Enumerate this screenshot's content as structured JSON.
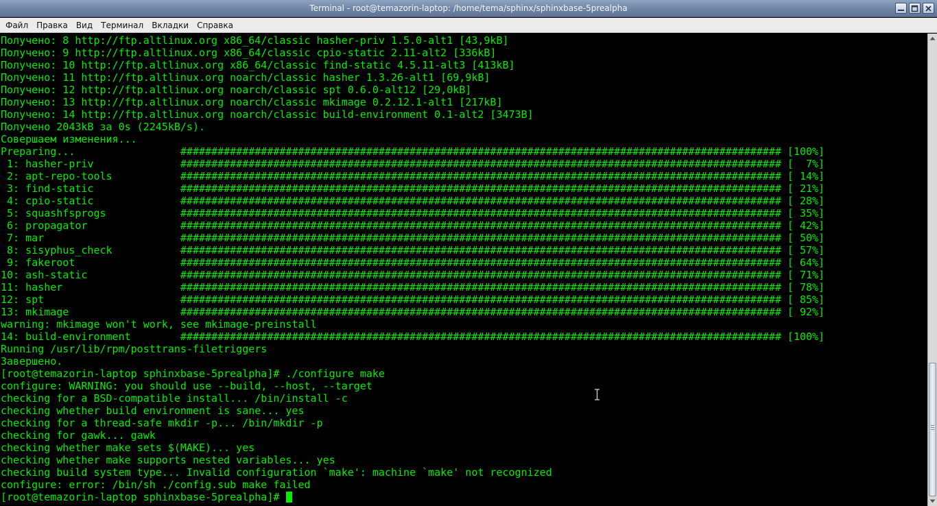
{
  "window": {
    "title": "Terminal - root@temazorin-laptop: /home/tema/sphinx/sphinxbase-5prealpha"
  },
  "menu": {
    "items": [
      "Файл",
      "Правка",
      "Вид",
      "Терминал",
      "Вкладки",
      "Справка"
    ]
  },
  "terminal": {
    "text_color": "#00ee00",
    "background": "#000000",
    "lines": [
      "Получено: 8 http://ftp.altlinux.org x86_64/classic hasher-priv 1.5.0-alt1 [43,9kB]",
      "Получено: 9 http://ftp.altlinux.org x86_64/classic cpio-static 2.11-alt2 [336kB]",
      "Получено: 10 http://ftp.altlinux.org x86_64/classic find-static 4.5.11-alt3 [413kB]",
      "Получено: 11 http://ftp.altlinux.org noarch/classic hasher 1.3.26-alt1 [69,9kB]",
      "Получено: 12 http://ftp.altlinux.org noarch/classic spt 0.6.0-alt12 [29,0kB]",
      "Получено: 13 http://ftp.altlinux.org noarch/classic mkimage 0.2.12.1-alt1 [217kB]",
      "Получено: 14 http://ftp.altlinux.org noarch/classic build-environment 0.1-alt2 [3473B]",
      "Получено 2043kB за 0s (2245kB/s).",
      "Совершаем изменения...",
      "Preparing...                 ################################################################################################# [100%]",
      " 1: hasher-priv              ################################################################################################# [  7%]",
      " 2: apt-repo-tools           ################################################################################################# [ 14%]",
      " 3: find-static              ################################################################################################# [ 21%]",
      " 4: cpio-static              ################################################################################################# [ 28%]",
      " 5: squashfsprogs            ################################################################################################# [ 35%]",
      " 6: propagator               ################################################################################################# [ 42%]",
      " 7: mar                      ################################################################################################# [ 50%]",
      " 8: sisyphus_check           ################################################################################################# [ 57%]",
      " 9: fakeroot                 ################################################################################################# [ 64%]",
      "10: ash-static               ################################################################################################# [ 71%]",
      "11: hasher                   ################################################################################################# [ 78%]",
      "12: spt                      ################################################################################################# [ 85%]",
      "13: mkimage                  ################################################################################################# [ 92%]",
      "warning: mkimage won't work, see mkimage-preinstall",
      "14: build-environment        ################################################################################################# [100%]",
      "Running /usr/lib/rpm/posttrans-filetriggers",
      "Завершено.",
      "[root@temazorin-laptop sphinxbase-5prealpha]# ./configure make",
      "configure: WARNING: you should use --build, --host, --target",
      "checking for a BSD-compatible install... /bin/install -c",
      "checking whether build environment is sane... yes",
      "checking for a thread-safe mkdir -p... /bin/mkdir -p",
      "checking for gawk... gawk",
      "checking whether make sets $(MAKE)... yes",
      "checking whether make supports nested variables... yes",
      "checking build system type... Invalid configuration `make': machine `make' not recognized",
      "configure: error: /bin/sh ./config.sub make failed"
    ],
    "prompt": "[root@temazorin-laptop sphinxbase-5prealpha]# "
  }
}
